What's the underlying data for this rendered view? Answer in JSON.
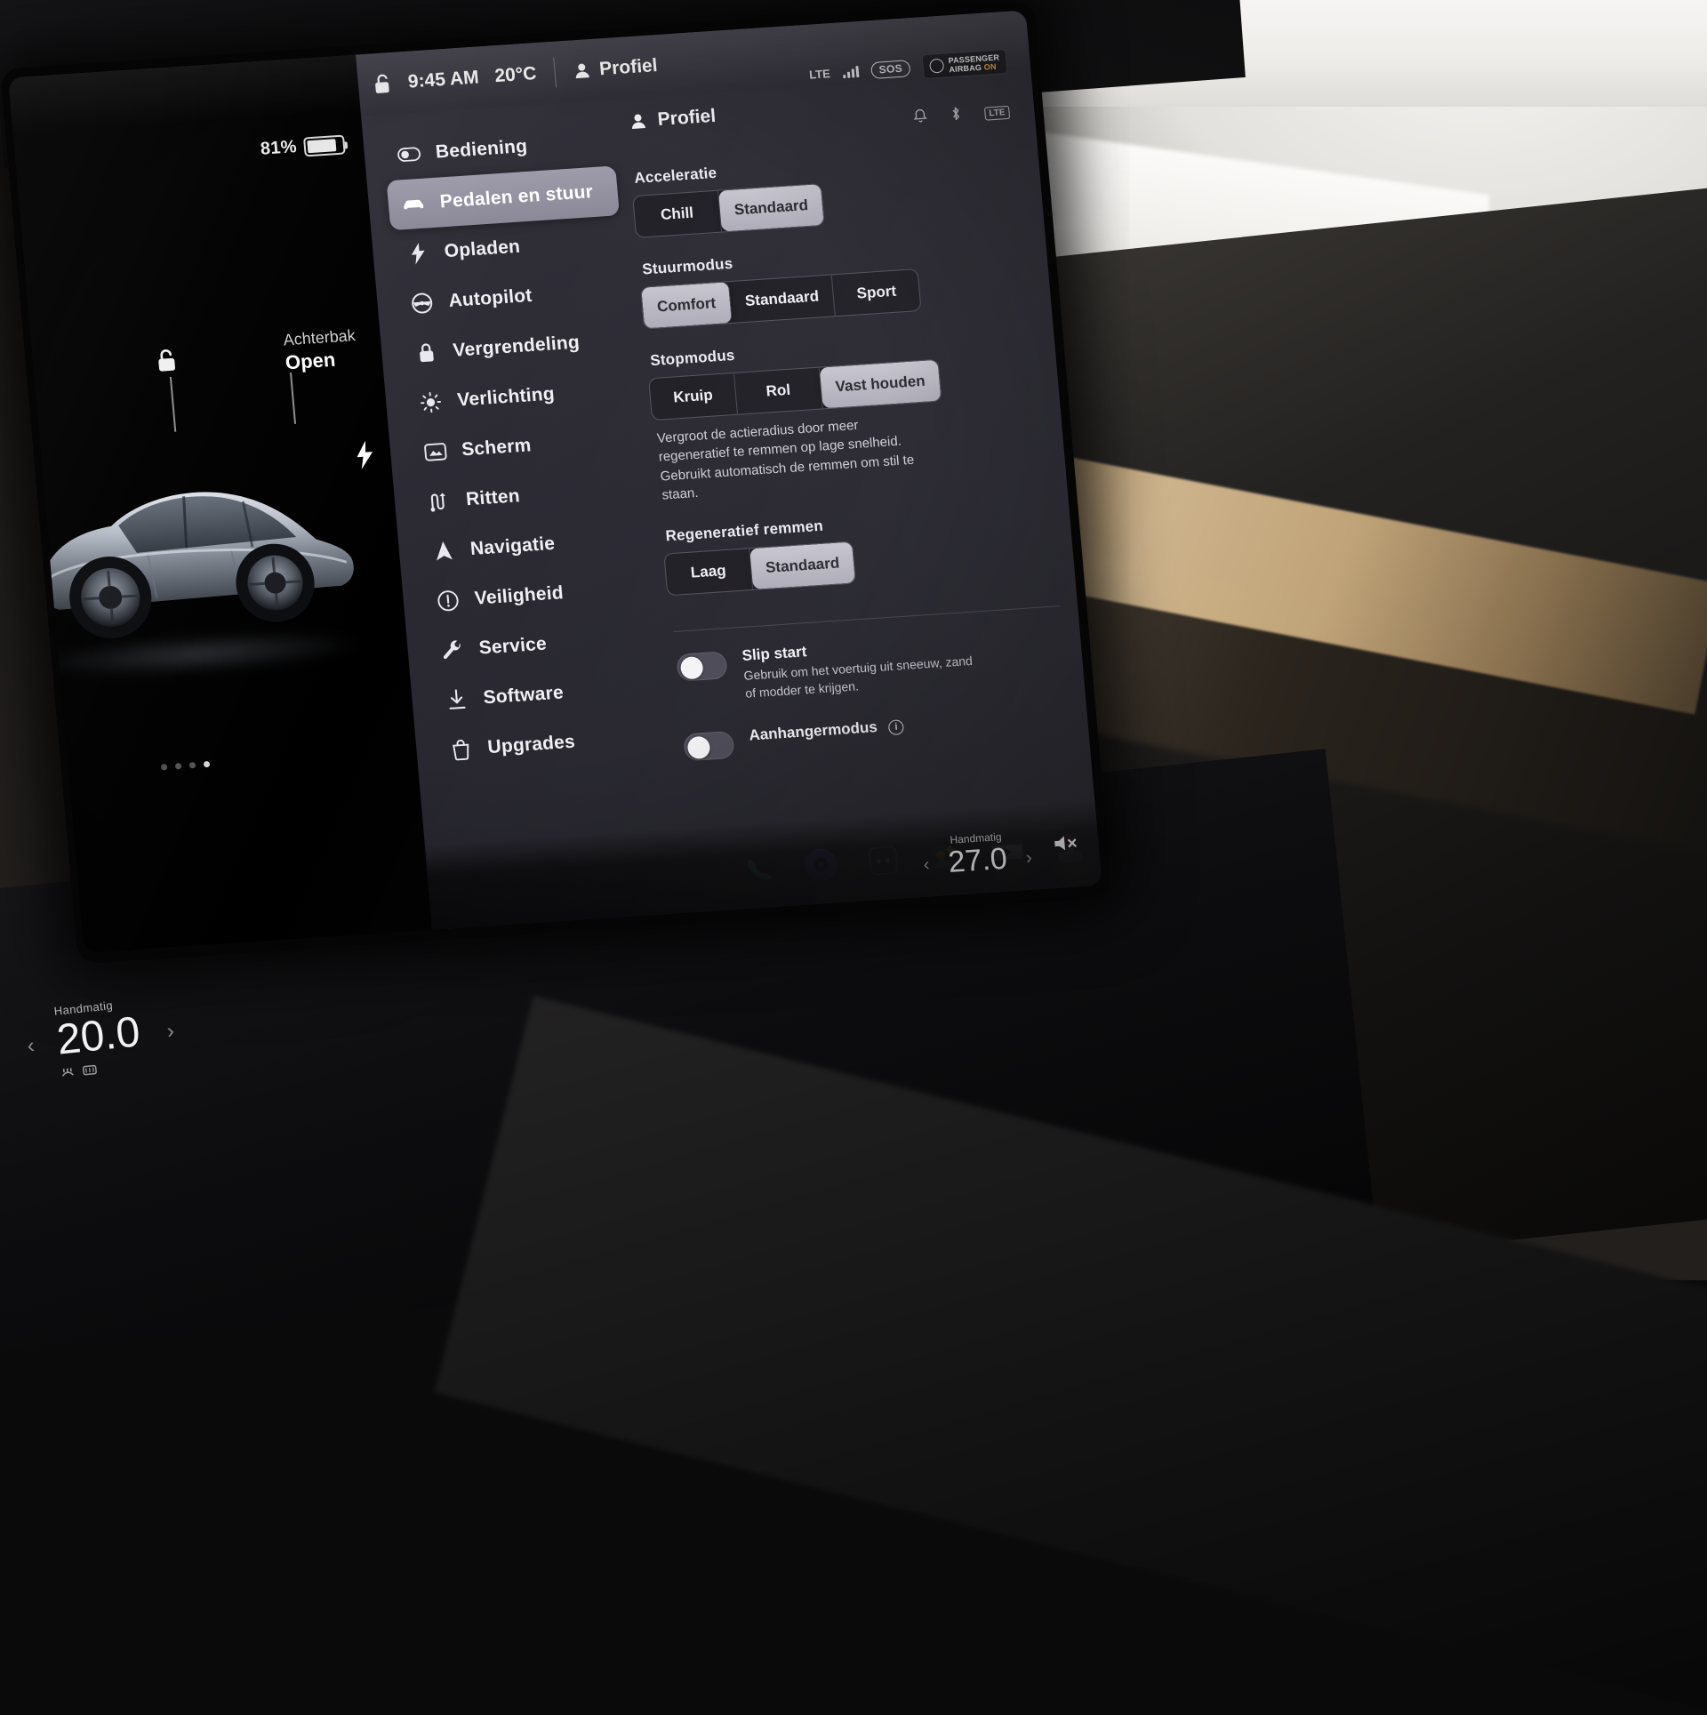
{
  "statusbar": {
    "lock_icon": "unlock-icon",
    "time": "9:45 AM",
    "temperature": "20°C",
    "profile_icon": "person-icon",
    "profile_label": "Profiel",
    "connectivity_label": "LTE",
    "sos_label": "SOS",
    "airbag_line1": "PASSENGER",
    "airbag_line2": "AIRBAG",
    "airbag_status": "ON",
    "lte_badge": "LTE"
  },
  "car_view": {
    "battery_percent": "81%",
    "battery_icon": "battery-icon",
    "frunk_label": "Achterbak",
    "frunk_state": "Open",
    "lock_icon": "unlocked-padlock-icon",
    "charge_icon": "charge-bolt-icon",
    "page_dots": 4,
    "active_dot": 4
  },
  "sidebar": {
    "items": [
      {
        "label": "Bediening",
        "icon": "toggle-switch-icon",
        "active": false
      },
      {
        "label": "Pedalen en stuur",
        "icon": "car-icon",
        "active": true
      },
      {
        "label": "Opladen",
        "icon": "bolt-icon",
        "active": false
      },
      {
        "label": "Autopilot",
        "icon": "steering-wheel-icon",
        "active": false
      },
      {
        "label": "Vergrendeling",
        "icon": "lock-icon",
        "active": false
      },
      {
        "label": "Verlichting",
        "icon": "brightness-icon",
        "active": false
      },
      {
        "label": "Scherm",
        "icon": "display-icon",
        "active": false
      },
      {
        "label": "Ritten",
        "icon": "trips-icon",
        "active": false
      },
      {
        "label": "Navigatie",
        "icon": "navigation-arrow-icon",
        "active": false
      },
      {
        "label": "Veiligheid",
        "icon": "alert-circle-icon",
        "active": false
      },
      {
        "label": "Service",
        "icon": "wrench-icon",
        "active": false
      },
      {
        "label": "Software",
        "icon": "download-icon",
        "active": false
      },
      {
        "label": "Upgrades",
        "icon": "shopping-bag-icon",
        "active": false
      }
    ]
  },
  "content": {
    "title": "Profiel",
    "title_icon": "person-icon",
    "sections": [
      {
        "label": "Acceleratie",
        "options": [
          "Chill",
          "Standaard"
        ],
        "selected": "Standaard",
        "description": ""
      },
      {
        "label": "Stuurmodus",
        "options": [
          "Comfort",
          "Standaard",
          "Sport"
        ],
        "selected": "Comfort",
        "description": ""
      },
      {
        "label": "Stopmodus",
        "options": [
          "Kruip",
          "Rol",
          "Vast houden"
        ],
        "selected": "Vast houden",
        "description": "Vergroot de actieradius door meer regeneratief te remmen op lage snelheid. Gebruikt automatisch de remmen om stil te staan."
      },
      {
        "label": "Regeneratief remmen",
        "options": [
          "Laag",
          "Standaard"
        ],
        "selected": "Standaard",
        "description": ""
      }
    ],
    "toggles": [
      {
        "title": "Slip start",
        "subtitle": "Gebruik om het voertuig uit sneeuw, zand of modder te krijgen.",
        "on": false,
        "has_info": false
      },
      {
        "title": "Aanhangermodus",
        "subtitle": "",
        "on": false,
        "has_info": true,
        "info_icon": "info-icon"
      }
    ]
  },
  "dock": {
    "items": [
      {
        "name": "phone-icon",
        "color": "#3ddc84"
      },
      {
        "name": "media-orb-icon",
        "color": "#7a4ddb"
      },
      {
        "name": "more-dots-icon",
        "color": "#cfcfd4"
      },
      {
        "name": "photos-icon",
        "color": "#f2a93b"
      },
      {
        "name": "video-icon",
        "color": "#efefef"
      },
      {
        "name": "arcade-icon",
        "color": "#e0524a"
      },
      {
        "name": "bluetooth-icon",
        "color": "#2f8ef0"
      }
    ]
  },
  "climate_left": {
    "mode_label": "Handmatig",
    "temperature": "20.0",
    "left_chevron": "‹",
    "right_chevron": "›"
  },
  "climate_right": {
    "mode_label": "Handmatig",
    "temperature": "27.0",
    "left_chevron": "‹",
    "right_chevron": "›",
    "mute_icon": "volume-mute-icon"
  }
}
